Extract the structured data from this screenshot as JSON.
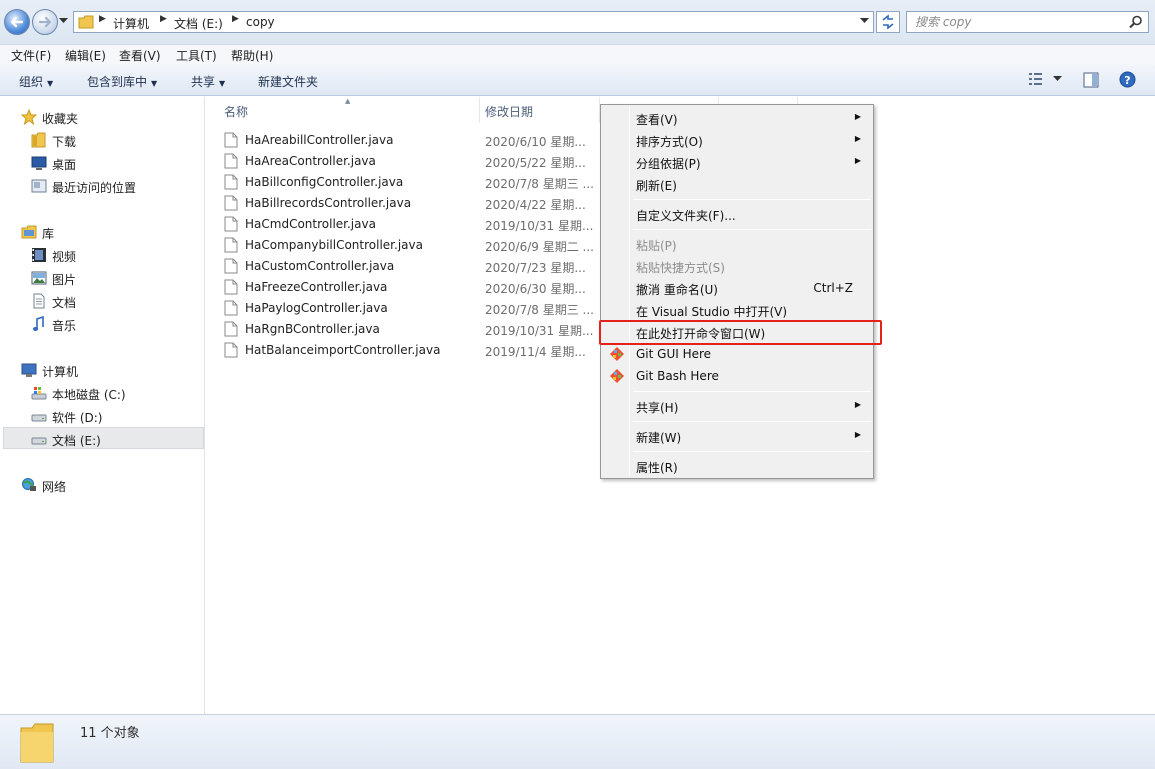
{
  "address": {
    "breadcrumbs": [
      "计算机",
      "文档 (E:)",
      "copy"
    ],
    "search_placeholder": "搜索 copy"
  },
  "menubar": [
    "文件(F)",
    "编辑(E)",
    "查看(V)",
    "工具(T)",
    "帮助(H)"
  ],
  "toolbar": {
    "organize": "组织",
    "include_library": "包含到库中",
    "share": "共享",
    "new_folder": "新建文件夹"
  },
  "sidebar": {
    "favorites": {
      "label": "收藏夹",
      "items": [
        "下载",
        "桌面",
        "最近访问的位置"
      ]
    },
    "libraries": {
      "label": "库",
      "items": [
        "视频",
        "图片",
        "文档",
        "音乐"
      ]
    },
    "computer": {
      "label": "计算机",
      "items": [
        "本地磁盘 (C:)",
        "软件 (D:)",
        "文档 (E:)"
      ]
    },
    "network": {
      "label": "网络"
    },
    "selected": "文档 (E:)"
  },
  "columns": {
    "name": "名称",
    "modified": "修改日期"
  },
  "files": [
    {
      "name": "HaAreabillController.java",
      "date": "2020/6/10 星期..."
    },
    {
      "name": "HaAreaController.java",
      "date": "2020/5/22 星期..."
    },
    {
      "name": "HaBillconfigController.java",
      "date": "2020/7/8 星期三 ..."
    },
    {
      "name": "HaBillrecordsController.java",
      "date": "2020/4/22 星期..."
    },
    {
      "name": "HaCmdController.java",
      "date": "2019/10/31 星期..."
    },
    {
      "name": "HaCompanybillController.java",
      "date": "2020/6/9 星期二 ..."
    },
    {
      "name": "HaCustomController.java",
      "date": "2020/7/23 星期..."
    },
    {
      "name": "HaFreezeController.java",
      "date": "2020/6/30 星期..."
    },
    {
      "name": "HaPaylogController.java",
      "date": "2020/7/8 星期三 ..."
    },
    {
      "name": "HaRgnBController.java",
      "date": "2019/10/31 星期..."
    },
    {
      "name": "HatBalanceimportController.java",
      "date": "2019/11/4 星期..."
    }
  ],
  "context_menu": {
    "view": "查看(V)",
    "sort": "排序方式(O)",
    "group": "分组依据(P)",
    "refresh": "刷新(E)",
    "customize": "自定义文件夹(F)...",
    "paste": "粘贴(P)",
    "paste_shortcut": "粘贴快捷方式(S)",
    "undo_rename": "撤消 重命名(U)",
    "undo_shortcut": "Ctrl+Z",
    "open_vs": "在 Visual Studio 中打开(V)",
    "open_cmd": "在此处打开命令窗口(W)",
    "git_gui": "Git GUI Here",
    "git_bash": "Git Bash Here",
    "share": "共享(H)",
    "new": "新建(W)",
    "properties": "属性(R)"
  },
  "status": {
    "count": "11 个对象"
  },
  "colors": {
    "highlight": "#e3231b",
    "accent": "#2d63b3"
  }
}
